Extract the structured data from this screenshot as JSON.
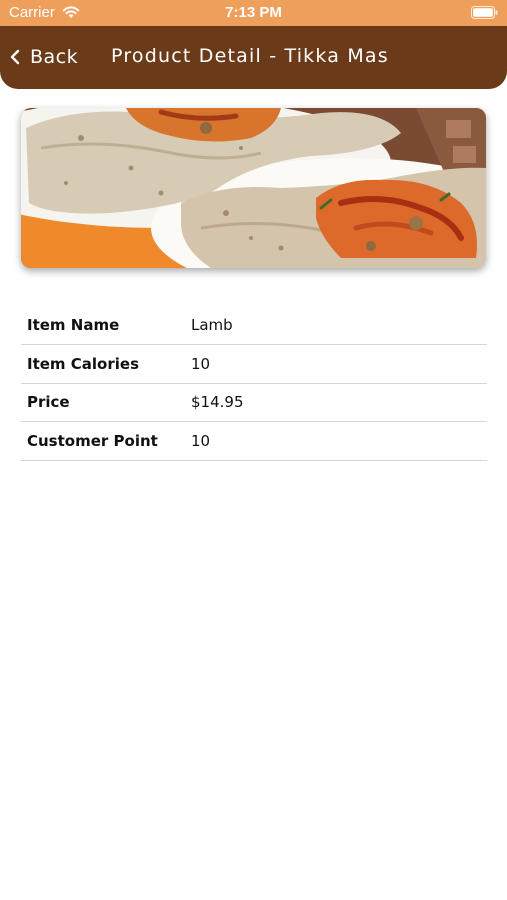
{
  "status_bar": {
    "carrier": "Carrier",
    "time": "7:13 PM",
    "wifi_icon": "wifi-icon",
    "battery_icon": "battery-icon"
  },
  "nav": {
    "back_label": "Back",
    "back_icon": "chevron-left-icon",
    "title": "Product Detail - Tikka Mas"
  },
  "product": {
    "image_icon": "food-photo"
  },
  "details": {
    "rows": [
      {
        "label": "Item Name",
        "value": "Lamb"
      },
      {
        "label": "Item Calories",
        "value": "10"
      },
      {
        "label": "Price",
        "value": "$14.95"
      },
      {
        "label": "Customer Point",
        "value": "10"
      }
    ]
  },
  "colors": {
    "status_bar": "#ee9f5b",
    "nav_bar": "#6b3a19",
    "divider": "#d6d6d6"
  }
}
